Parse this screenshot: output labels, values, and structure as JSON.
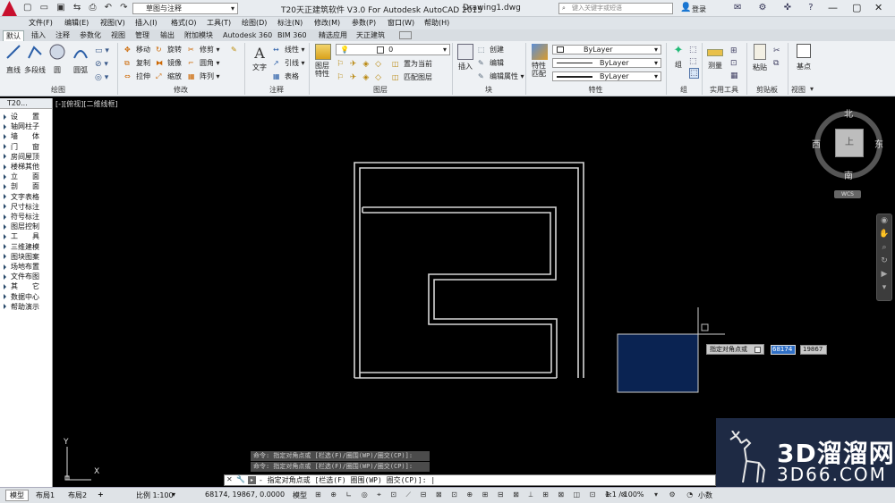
{
  "titlebar": {
    "workspace": "草图与注释",
    "title": "T20天正建筑软件 V3.0 For Autodesk AutoCAD 2015",
    "drawing": "Drawing1.dwg",
    "search_placeholder": "键入关键字或短语",
    "login": "登录"
  },
  "menu": [
    "文件(F)",
    "编辑(E)",
    "视图(V)",
    "插入(I)",
    "格式(O)",
    "工具(T)",
    "绘图(D)",
    "标注(N)",
    "修改(M)",
    "参数(P)",
    "窗口(W)",
    "帮助(H)"
  ],
  "tabs": [
    "默认",
    "插入",
    "注释",
    "参数化",
    "视图",
    "管理",
    "输出",
    "附加模块",
    "Autodesk 360",
    "BIM 360",
    "精选应用",
    "天正建筑"
  ],
  "ribbon": {
    "draw": {
      "line": "直线",
      "polyline": "多段线",
      "circle": "圆",
      "arc": "圆弧",
      "panel": "绘图"
    },
    "modify": {
      "move": "移动",
      "rotate": "旋转",
      "trim": "修剪",
      "copy": "复制",
      "mirror": "镜像",
      "fillet": "圆角",
      "stretch": "拉伸",
      "scale": "缩放",
      "array": "阵列",
      "panel": "修改"
    },
    "annotation": {
      "text": "文字",
      "linear": "线性",
      "leader": "引线",
      "table": "表格",
      "panel": "注释"
    },
    "layers": {
      "layer_props": "图层特性",
      "current": "0",
      "make_current": "置为当前",
      "match": "匹配图层",
      "panel": "图层"
    },
    "block": {
      "insert": "插入",
      "create": "创建",
      "edit": "编辑",
      "edit_attr": "编辑属性",
      "panel": "块"
    },
    "properties": {
      "match": "特性匹配",
      "bylayer1": "ByLayer",
      "bylayer2": "ByLayer",
      "bylayer3": "ByLayer",
      "panel": "特性"
    },
    "groups": {
      "group": "组",
      "panel": "组"
    },
    "utilities": {
      "measure": "测量",
      "panel": "实用工具"
    },
    "clipboard": {
      "paste": "粘贴",
      "panel": "剪贴板"
    },
    "view": {
      "base": "基点",
      "panel": "视图"
    }
  },
  "sidebar": {
    "title": "T20...",
    "items": [
      "设　　置",
      "轴网柱子",
      "墙　　体",
      "门　　窗",
      "房间屋顶",
      "楼梯其他",
      "立　　面",
      "剖　　面",
      "文字表格",
      "尺寸标注",
      "符号标注",
      "图层控制",
      "工　　具",
      "三维建模",
      "图块图案",
      "场地布置",
      "文件布图",
      "其　　它",
      "数据中心",
      "帮助演示"
    ]
  },
  "viewport": {
    "label": "[-][俯视][二维线框]",
    "viewcube": {
      "north": "北",
      "south": "南",
      "east": "东",
      "west": "西",
      "center": "上",
      "wcs": "WCS"
    },
    "axis_x": "X",
    "axis_y": "Y",
    "tooltip": {
      "prompt": "指定对角点或",
      "x": "68174",
      "y": "19867"
    }
  },
  "command": {
    "history1": "命令: 指定对角点或 [栏选(F)/圈围(WP)/圈交(CP)]:",
    "history2": "命令: 指定对角点或 [栏选(F)/圈围(WP)/圈交(CP)]:",
    "prompt": "- 指定对角点或 [栏选(F) 圈围(WP) 圈交(CP)]: |"
  },
  "status": {
    "tab_model": "模型",
    "tab_layout1": "布局1",
    "tab_layout2": "布局2",
    "scale": "比例 1:100",
    "coords": "68174, 19867, 0.0000",
    "mode": "模型",
    "zoom": "1:1 / 100%",
    "decimal": "小数"
  },
  "watermark": {
    "text1": "3D溜溜网",
    "text2": "3D66.COM"
  }
}
